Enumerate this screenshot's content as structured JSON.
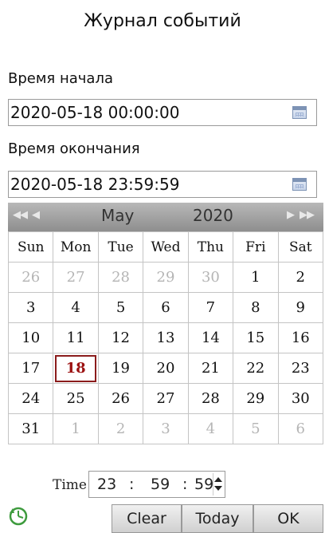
{
  "page": {
    "title": "Журнал событий"
  },
  "start": {
    "label": "Время начала",
    "value": "2020-05-18 00:00:00"
  },
  "end": {
    "label": "Время окончания",
    "value": "2020-05-18 23:59:59"
  },
  "calendar": {
    "nav_prev_year": "◀◀",
    "nav_prev_month": "◀",
    "nav_next_month": "▶",
    "nav_next_year": "▶▶",
    "month": "May",
    "year": "2020",
    "weekdays": [
      "Sun",
      "Mon",
      "Tue",
      "Wed",
      "Thu",
      "Fri",
      "Sat"
    ],
    "weeks": [
      [
        "26",
        "27",
        "28",
        "29",
        "30",
        "1",
        "2"
      ],
      [
        "3",
        "4",
        "5",
        "6",
        "7",
        "8",
        "9"
      ],
      [
        "10",
        "11",
        "12",
        "13",
        "14",
        "15",
        "16"
      ],
      [
        "17",
        "18",
        "19",
        "20",
        "21",
        "22",
        "23"
      ],
      [
        "24",
        "25",
        "26",
        "27",
        "28",
        "29",
        "30"
      ],
      [
        "31",
        "1",
        "2",
        "3",
        "4",
        "5",
        "6"
      ]
    ],
    "selected": "18"
  },
  "time": {
    "label": "Time",
    "hours": "23",
    "minutes": "59",
    "seconds": "59",
    "separator": ":"
  },
  "buttons": {
    "clear": "Clear",
    "today": "Today",
    "ok": "OK"
  },
  "colors": {
    "header": "#a4a4a4",
    "today_outline": "#8b1c1c",
    "other_month": "#b5b5b5"
  }
}
